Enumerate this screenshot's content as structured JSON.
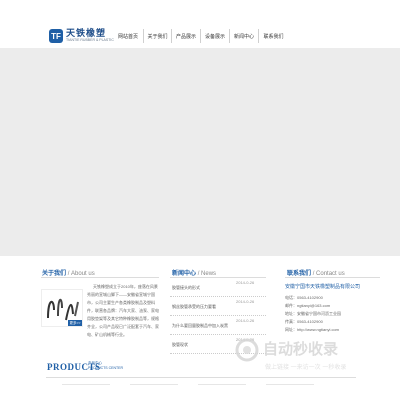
{
  "brand": {
    "mark": "TF",
    "name_cn": "天铁橡塑",
    "name_en": "TIANTIE RUBBER & PLASTIC"
  },
  "nav": {
    "items": [
      {
        "label": "网站首页"
      },
      {
        "label": "关于我们"
      },
      {
        "label": "产品展示"
      },
      {
        "label": "设备展示"
      },
      {
        "label": "新闻中心"
      },
      {
        "label": "联系我们"
      }
    ]
  },
  "about": {
    "title_cn": "关于我们",
    "title_en": "/ About us",
    "text": "天铁橡塑成立于2010年，座落在风景秀丽的宣城山脚下——安徽省宣城宁国市，公司主要生产各类橡胶制品及塑料件，联营各品牌：汽车大家、油泵、家电用胶垫架等及其它特种橡胶制品等，规格齐全，公司产品现已广泛配套于汽车、家电、矿山机械等行业。",
    "more": "更多>>"
  },
  "news": {
    "title_cn": "新闻中心",
    "title_en": "/ News",
    "items": [
      {
        "title": "胶管接头的形式",
        "date": "2014-0-26"
      },
      {
        "title": "钢丝胶管承受的压力要看",
        "date": "2014-0-26"
      },
      {
        "title": "为什么要回量胶制品中加入炭黑",
        "date": "2014-0-26"
      },
      {
        "title": "胶管现状",
        "date": "2014-0-26"
      }
    ]
  },
  "contact": {
    "title_cn": "联系我们",
    "title_en": "/ Contact us",
    "company": "安徽宁国市天铁橡塑制品有限公司",
    "lines": [
      "电话：0563-4102900",
      "邮件：ngtianyi@163.com",
      "地址：安徽省宁国市河沥工业园",
      "传真：0563-4102900",
      "网址：http://www.ngtianyi.com"
    ]
  },
  "products": {
    "title": "PRODUCTS",
    "sub_cn": "产品中心",
    "sub_en": "PRODUCTS CENTER"
  },
  "watermark": {
    "main": "自动秒收录",
    "sub": "做上链接 一来访一次 一秒收录"
  },
  "colors": {
    "brand_blue": "#1f5fa6",
    "banner_gray": "#ececec"
  }
}
